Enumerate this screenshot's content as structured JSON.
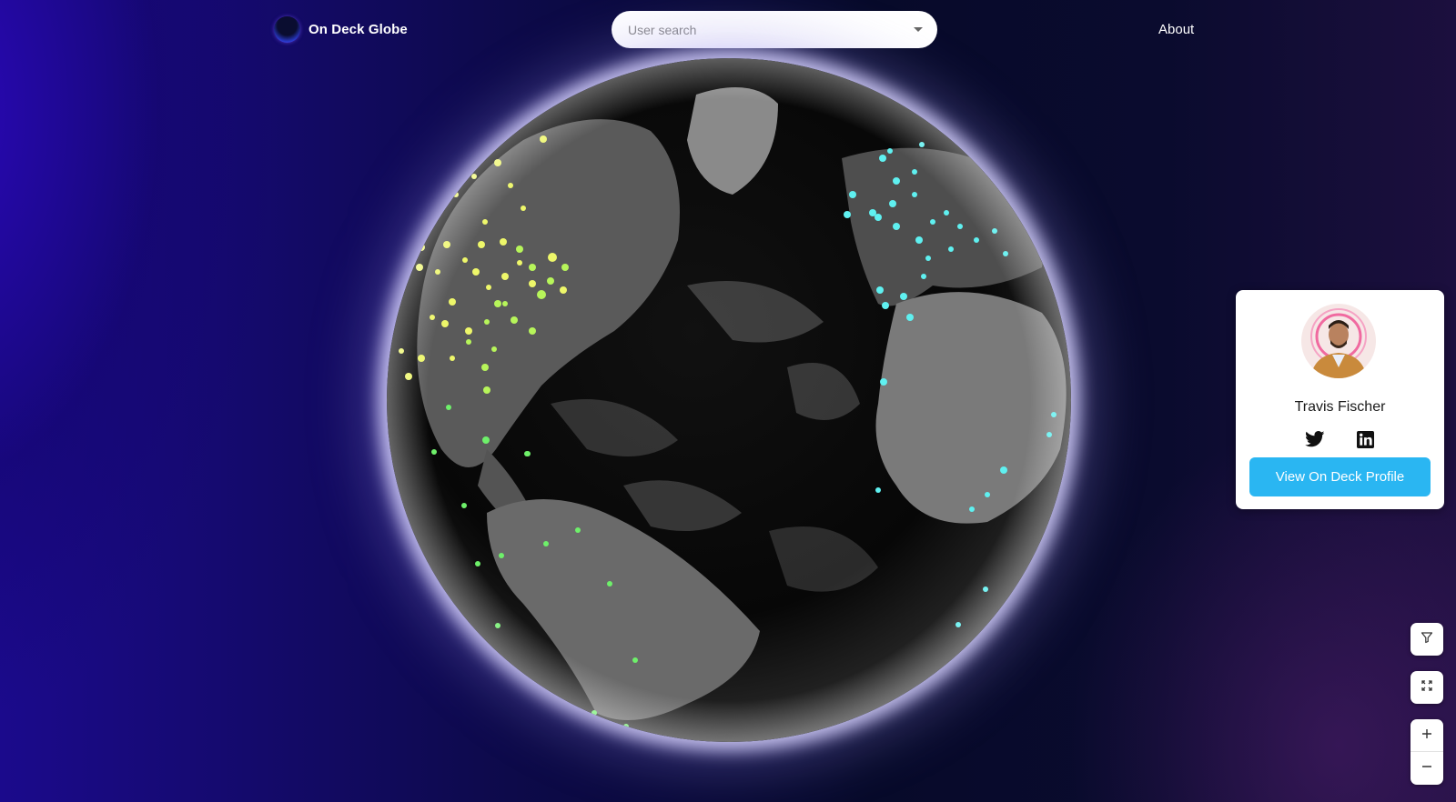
{
  "header": {
    "brand_name": "On Deck Globe",
    "search": {
      "placeholder": "User search",
      "value": ""
    },
    "about_label": "About"
  },
  "profile_card": {
    "name": "Travis Fischer",
    "social_icons": [
      "twitter-icon",
      "linkedin-icon"
    ],
    "button_label": "View On Deck Profile",
    "button_color": "#2ab6f2"
  },
  "map_controls": {
    "icons": [
      "filter-icon",
      "fullscreen-icon",
      "zoom-in-icon",
      "zoom-out-icon"
    ]
  },
  "colors": {
    "glow": "#d7d2ff",
    "marker_north_america": "#eef76a",
    "marker_central": "#7df06a",
    "marker_europe": "#5ff0f0"
  }
}
